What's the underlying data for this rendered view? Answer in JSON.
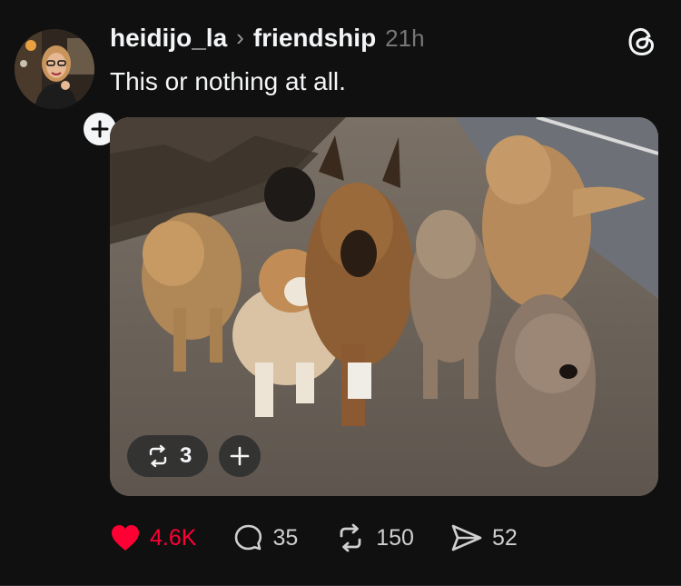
{
  "post": {
    "username": "heidijo_la",
    "separator": "›",
    "topic": "friendship",
    "time": "21h",
    "text": "This or nothing at all."
  },
  "media": {
    "repost_count": "3"
  },
  "actions": {
    "likes": "4.6K",
    "replies": "35",
    "reposts": "150",
    "shares": "52"
  },
  "colors": {
    "background": "#101010",
    "like_active": "#fe0034",
    "text_primary": "#f3f5f7",
    "text_muted": "#777777"
  },
  "icons": [
    "plus-icon",
    "threads-logo-icon",
    "repost-icon",
    "heart-icon",
    "comment-icon",
    "send-icon"
  ]
}
